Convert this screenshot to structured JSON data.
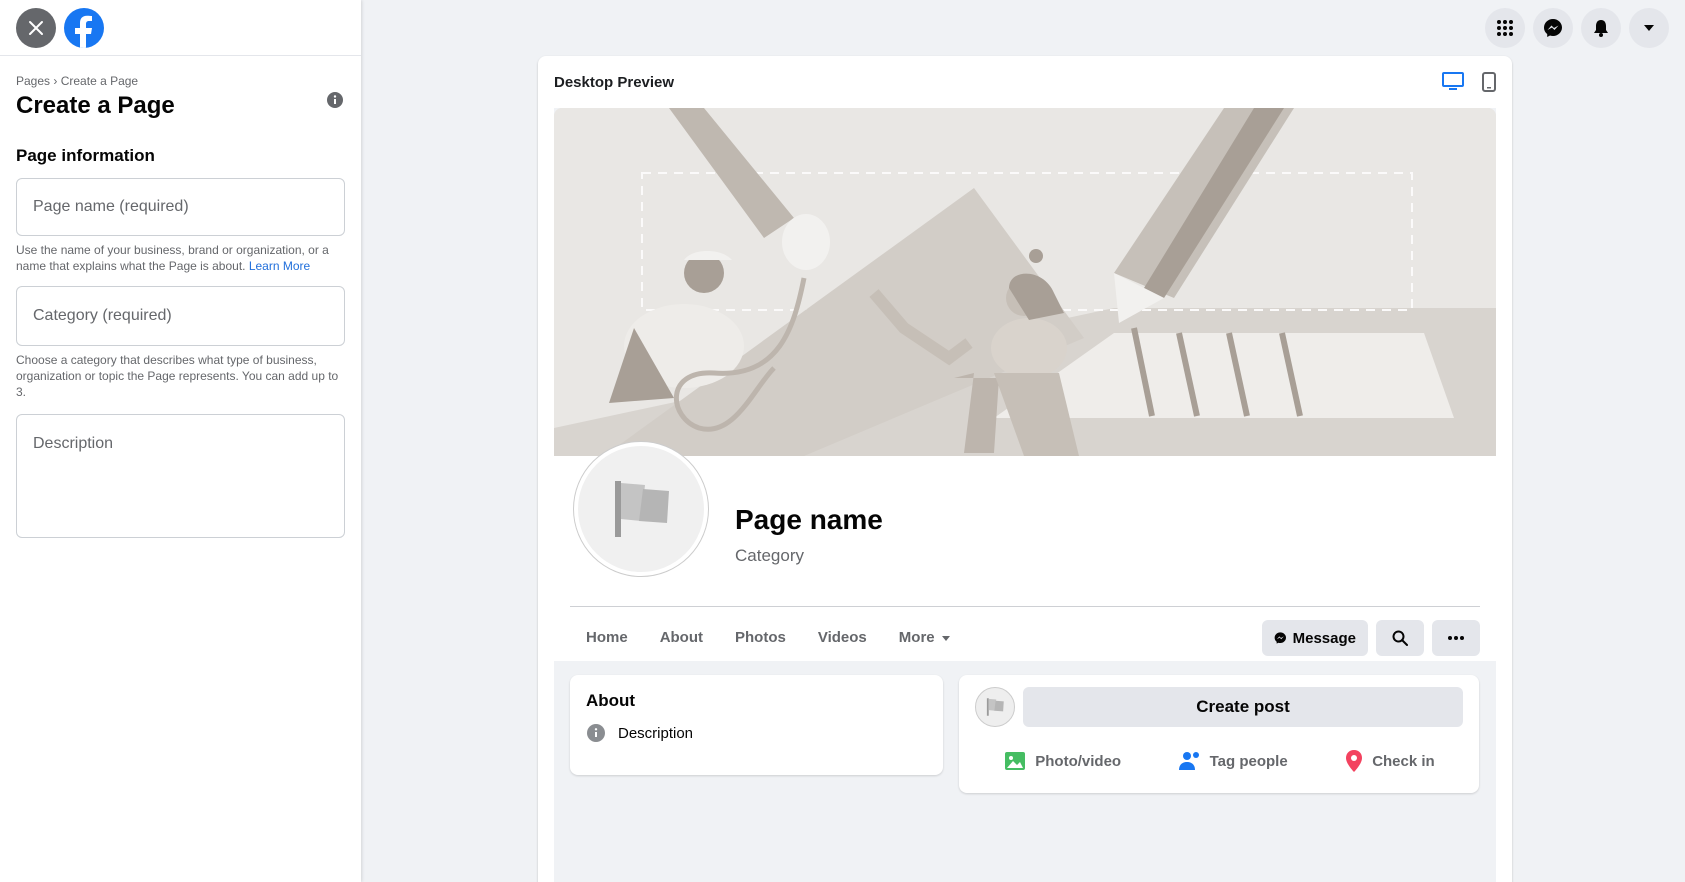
{
  "sidebar": {
    "breadcrumb": {
      "parent": "Pages",
      "separator": "›",
      "current": "Create a Page"
    },
    "title": "Create a Page",
    "section_title": "Page information",
    "page_name": {
      "placeholder": "Page name (required)",
      "value": ""
    },
    "page_name_help": "Use the name of your business, brand or organization, or a name that explains what the Page is about.",
    "learn_more": "Learn More",
    "category": {
      "placeholder": "Category (required)",
      "value": ""
    },
    "category_help": "Choose a category that describes what type of business, organization or topic the Page represents. You can add up to 3.",
    "description": {
      "placeholder": "Description",
      "value": ""
    }
  },
  "preview": {
    "title": "Desktop Preview",
    "page_name": "Page name",
    "category": "Category",
    "tabs": [
      {
        "label": "Home"
      },
      {
        "label": "About"
      },
      {
        "label": "Photos"
      },
      {
        "label": "Videos"
      },
      {
        "label": "More"
      }
    ],
    "message_label": "Message",
    "about": {
      "title": "About",
      "description": "Description"
    },
    "create_post": "Create post",
    "post_actions": [
      {
        "label": "Photo/video",
        "icon": "photo-icon",
        "color": "#45bd62"
      },
      {
        "label": "Tag people",
        "icon": "tag-people-icon",
        "color": "#1877f2"
      },
      {
        "label": "Check in",
        "icon": "location-pin-icon",
        "color": "#f3425f"
      }
    ]
  },
  "colors": {
    "brand": "#1877f2",
    "link": "#216fdb",
    "active_device": "#1877f2"
  }
}
